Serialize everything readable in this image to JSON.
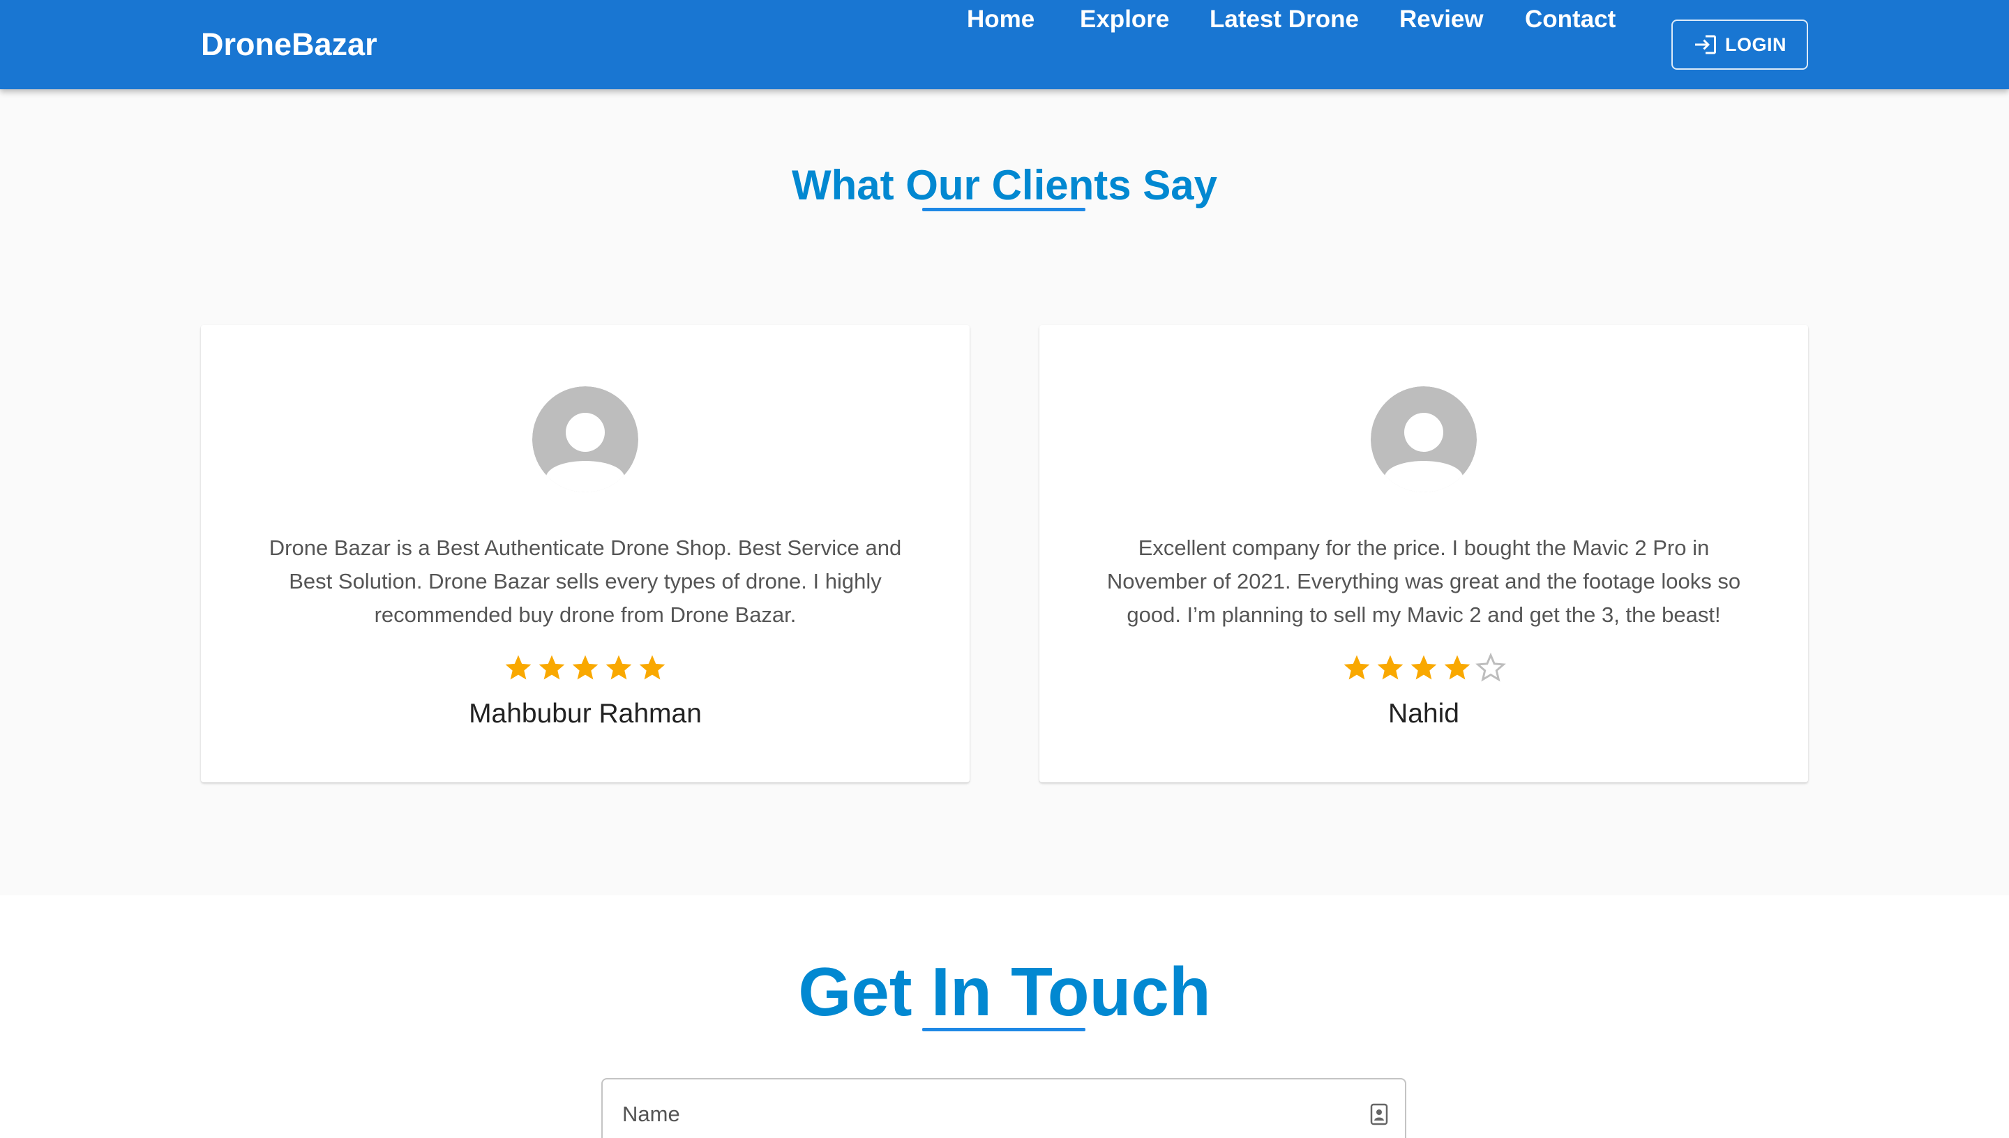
{
  "header": {
    "brand": "DroneBazar",
    "nav": [
      "Home",
      "Explore",
      "Latest Drone",
      "Review",
      "Contact"
    ],
    "login_label": "LOGIN"
  },
  "reviews_section": {
    "title": "What Our Clients Say",
    "reviews": [
      {
        "text": "Drone Bazar is a Best Authenticate Drone Shop. Best Service and Best Solution. Drone Bazar sells every types of drone. I highly recommended buy drone from Drone Bazar.",
        "rating": 5,
        "max_rating": 5,
        "name": "Mahbubur Rahman"
      },
      {
        "text": "Excellent company for the price. I bought the Mavic 2 Pro in November of 2021. Everything was great and the footage looks so good. I’m planning to sell my Mavic 2 and get the 3, the beast!",
        "rating": 4,
        "max_rating": 5,
        "name": "Nahid"
      }
    ]
  },
  "contact_section": {
    "title": "Get In Touch",
    "name_placeholder": "Name"
  },
  "colors": {
    "appbar": "#1976d2",
    "heading": "#0288d1",
    "underline": "#1e88e5",
    "star": "#f9a800",
    "star_empty": "#bdbdbd"
  }
}
